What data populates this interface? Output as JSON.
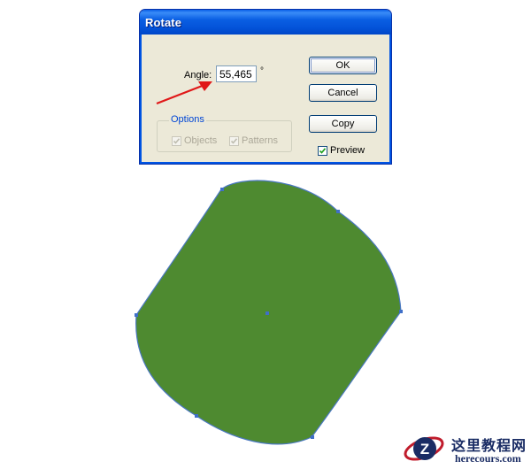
{
  "dialog": {
    "title": "Rotate",
    "angle_label": "Angle:",
    "angle_value": "55,465",
    "degree_symbol": "°",
    "options": {
      "legend": "Options",
      "objects": {
        "label": "Objects",
        "checked": true,
        "enabled": false
      },
      "patterns": {
        "label": "Patterns",
        "checked": true,
        "enabled": false
      }
    },
    "buttons": {
      "ok": "OK",
      "cancel": "Cancel",
      "copy": "Copy"
    },
    "preview": {
      "label": "Preview",
      "checked": true
    }
  },
  "annotation": {
    "arrow_color": "#e01818",
    "points_to": "angle-input"
  },
  "artwork": {
    "shape": "rounded rectangle rotated",
    "fill_color": "#4e8a30",
    "outline_color": "#4a78c0"
  },
  "watermark": {
    "chinese_text": "这里教程网",
    "url_text": "herecours.com",
    "logo_letter": "Z"
  }
}
